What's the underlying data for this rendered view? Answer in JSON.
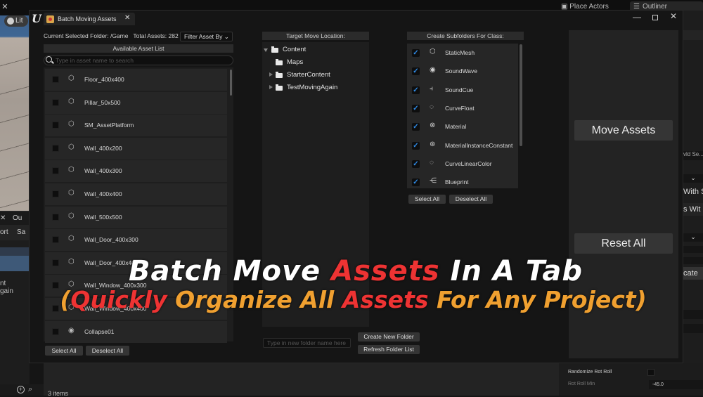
{
  "background_editor": {
    "viewport_mode": "Lit",
    "place_actors_tab": "Place Actors",
    "outliner_tab": "Outliner",
    "left_tabs": [
      "✕",
      "Ou"
    ],
    "left_toolbar": [
      "ort",
      "Sa"
    ],
    "left_tree_text": [
      "nt",
      "gain"
    ],
    "items_count": "3 items",
    "right_panel_snippets": [
      "vld Se...",
      "With S",
      "s Wit",
      "cate"
    ],
    "details": {
      "randomize_rot_roll_label": "Randomize Rot Roll",
      "randomize_rot_roll_checked": false,
      "rot_roll_min_label": "Rot Roll Min",
      "rot_roll_min_value": "-45.0"
    }
  },
  "window": {
    "tab_title": "Batch Moving Assets",
    "controls": {
      "minimize": "—",
      "close": "✕"
    }
  },
  "asset_panel": {
    "current_folder_label": "Current Selected Folder: /Game",
    "total_assets_label": "Total Assets: 282",
    "filter_button": "Filter Asset By",
    "list_header": "Available Asset List",
    "search_placeholder": "Type in asset name to search",
    "assets": [
      {
        "name": "Floor_400x400",
        "icon": "static-mesh-icon",
        "checked": false
      },
      {
        "name": "Pillar_50x500",
        "icon": "static-mesh-icon",
        "checked": false
      },
      {
        "name": "SM_AssetPlatform",
        "icon": "static-mesh-icon",
        "checked": false
      },
      {
        "name": "Wall_400x200",
        "icon": "static-mesh-icon",
        "checked": false
      },
      {
        "name": "Wall_400x300",
        "icon": "static-mesh-icon",
        "checked": false
      },
      {
        "name": "Wall_400x400",
        "icon": "static-mesh-icon",
        "checked": false
      },
      {
        "name": "Wall_500x500",
        "icon": "static-mesh-icon",
        "checked": false
      },
      {
        "name": "Wall_Door_400x300",
        "icon": "static-mesh-icon",
        "checked": false
      },
      {
        "name": "Wall_Door_400x400",
        "icon": "static-mesh-icon",
        "checked": false
      },
      {
        "name": "Wall_Window_400x300",
        "icon": "static-mesh-icon",
        "checked": false
      },
      {
        "name": "Wall_Window_400x400",
        "icon": "static-mesh-icon",
        "checked": false
      },
      {
        "name": "Collapse01",
        "icon": "sound-wave-icon",
        "checked": false
      }
    ],
    "select_all": "Select All",
    "deselect_all": "Deselect All"
  },
  "target_panel": {
    "header": "Target Move Location:",
    "tree": [
      {
        "label": "Content",
        "expanded": true,
        "level": 0
      },
      {
        "label": "Maps",
        "expanded": null,
        "level": 1
      },
      {
        "label": "StarterContent",
        "expanded": false,
        "level": 1
      },
      {
        "label": "TestMovingAgain",
        "expanded": false,
        "level": 1
      }
    ],
    "new_folder_placeholder": "Type in new folder name here",
    "create_folder_button": "Create New Folder",
    "refresh_button": "Refresh Folder List"
  },
  "class_panel": {
    "header": "Create Subfolders For Class:",
    "classes": [
      {
        "name": "StaticMesh",
        "icon": "static-mesh-icon",
        "glyph": "⬡",
        "checked": true
      },
      {
        "name": "SoundWave",
        "icon": "sound-wave-icon",
        "glyph": "◉",
        "checked": true
      },
      {
        "name": "SoundCue",
        "icon": "sound-cue-icon",
        "glyph": "⫞",
        "checked": true
      },
      {
        "name": "CurveFloat",
        "icon": "curve-icon",
        "glyph": "◌",
        "checked": true
      },
      {
        "name": "Material",
        "icon": "material-icon",
        "glyph": "⊗",
        "checked": true
      },
      {
        "name": "MaterialInstanceConstant",
        "icon": "material-instance-icon",
        "glyph": "⊛",
        "checked": true
      },
      {
        "name": "CurveLinearColor",
        "icon": "curve-icon",
        "glyph": "◌",
        "checked": true
      },
      {
        "name": "Blueprint",
        "icon": "blueprint-icon",
        "glyph": "⋲",
        "checked": true
      }
    ],
    "check_glyph": "✓",
    "select_all": "Select All",
    "deselect_all": "Deselect All"
  },
  "actions": {
    "move_assets": "Move Assets",
    "reset_all": "Reset All"
  },
  "overlay": {
    "line1": [
      "Batch Move ",
      "Assets",
      " In A Tab"
    ],
    "line2": [
      "(",
      "Quickly",
      " Organize All ",
      "Assets",
      " For Any Project",
      ")"
    ]
  },
  "colors": {
    "accent_check": "#2e8ae6",
    "overlay_red": "#ee3333",
    "overlay_orange": "#f0a030"
  }
}
